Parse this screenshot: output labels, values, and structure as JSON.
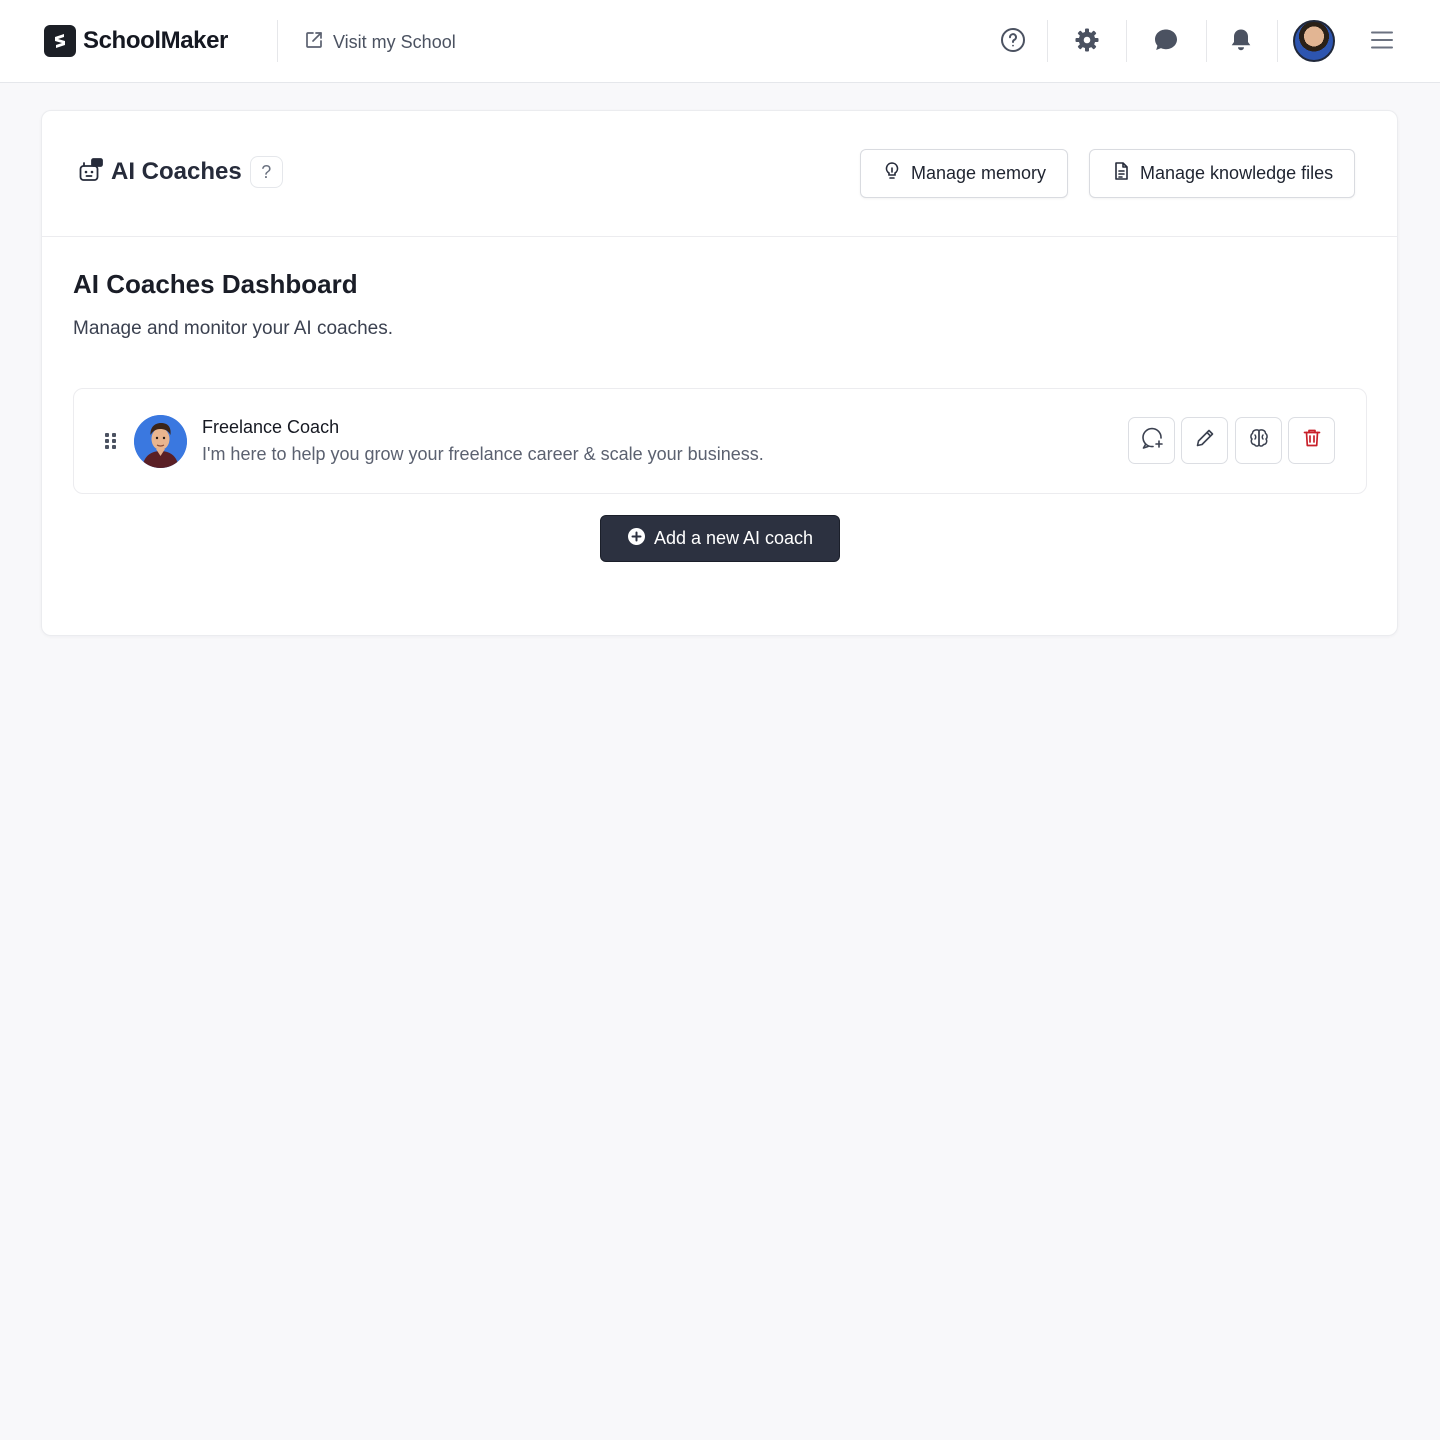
{
  "header": {
    "brand": "SchoolMaker",
    "visit_label": "Visit my School",
    "icons": [
      "external-link-icon",
      "help-circle-icon",
      "gear-icon",
      "chat-bubble-icon",
      "bell-icon",
      "user-avatar",
      "hamburger-menu-icon"
    ]
  },
  "page": {
    "title": "AI Coaches",
    "help_label": "?",
    "manage_memory_label": "Manage memory",
    "manage_knowledge_label": "Manage knowledge files",
    "dashboard_title": "AI Coaches Dashboard",
    "dashboard_subtitle": "Manage and monitor your AI coaches."
  },
  "coaches": [
    {
      "name": "Freelance Coach",
      "description": "I'm here to help you grow your freelance career & scale your business.",
      "actions": [
        "chat-plus-icon",
        "pencil-icon",
        "brain-icon",
        "trash-icon"
      ]
    }
  ],
  "add_button_label": "Add a new AI coach",
  "colors": {
    "accent_dark": "#2c3140",
    "danger": "#c8202a",
    "page_bg": "#f8f8fa"
  }
}
